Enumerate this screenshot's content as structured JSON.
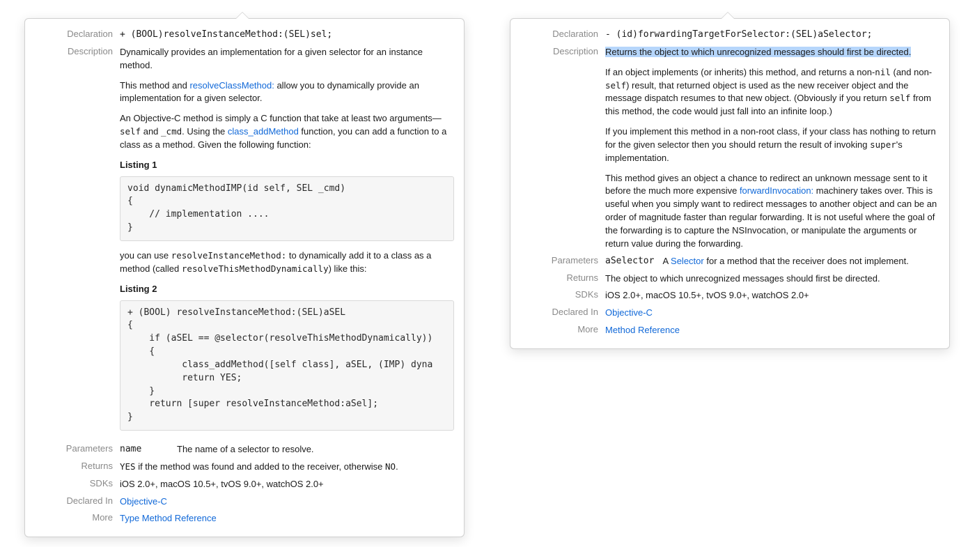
{
  "left": {
    "labels": {
      "declaration": "Declaration",
      "description": "Description",
      "parameters": "Parameters",
      "returns": "Returns",
      "sdks": "SDKs",
      "declaredIn": "Declared In",
      "more": "More"
    },
    "declaration": "+ (BOOL)resolveInstanceMethod:(SEL)sel;",
    "desc": {
      "p1": "Dynamically provides an implementation for a given selector for an instance method.",
      "p2a": "This method and ",
      "p2link": "resolveClassMethod:",
      "p2b": " allow you to dynamically provide an implementation for a given selector.",
      "p3a": "An Objective-C method is simply a C function that take at least two arguments—",
      "p3self": "self",
      "p3b": " and ",
      "p3cmd": "_cmd",
      "p3c": ". Using the ",
      "p3link": "class_addMethod",
      "p3d": " function, you can add a function to a class as a method. Given the following function:",
      "listing1_title": "Listing 1",
      "code1": "void dynamicMethodIMP(id self, SEL _cmd)\n{\n    // implementation ....\n}",
      "p4a": "you can use ",
      "p4code1": "resolveInstanceMethod:",
      "p4b": " to dynamically add it to a class as a method (called ",
      "p4code2": "resolveThisMethodDynamically",
      "p4c": ") like this:",
      "listing2_title": "Listing 2",
      "code2": "+ (BOOL) resolveInstanceMethod:(SEL)aSEL\n{\n    if (aSEL == @selector(resolveThisMethodDynamically))\n    {\n          class_addMethod([self class], aSEL, (IMP) dyna\n          return YES;\n    }\n    return [super resolveInstanceMethod:aSel];\n}"
    },
    "param": {
      "name": "name",
      "text": "The name of a selector to resolve."
    },
    "returns_a": "YES",
    "returns_b": " if the method was found and added to the receiver, otherwise ",
    "returns_c": "NO",
    "returns_d": ".",
    "sdks": "iOS 2.0+, macOS 10.5+, tvOS 9.0+, watchOS 2.0+",
    "declaredIn": "Objective-C",
    "more": "Type Method Reference"
  },
  "right": {
    "labels": {
      "declaration": "Declaration",
      "description": "Description",
      "parameters": "Parameters",
      "returns": "Returns",
      "sdks": "SDKs",
      "declaredIn": "Declared In",
      "more": "More"
    },
    "declaration": "- (id)forwardingTargetForSelector:(SEL)aSelector;",
    "desc": {
      "p1_hl": "Returns the object to which unrecognized messages should first be directed.",
      "p2a": "If an object implements (or inherits) this method, and returns a non-",
      "p2nil": "nil",
      "p2b": " (and non-",
      "p2self": "self",
      "p2c": ") result, that returned object is used as the new receiver object and the message dispatch resumes to that new object. (Obviously if you return ",
      "p2self2": "self",
      "p2d": " from this method, the code would just fall into an infinite loop.)",
      "p3a": "If you implement this method in a non-root class, if your class has nothing to return for the given selector then you should return the result of invoking ",
      "p3super": "super",
      "p3b": "'s implementation.",
      "p4a": "This method gives an object a chance to redirect an unknown message sent to it before the much more expensive ",
      "p4link": "forwardInvocation:",
      "p4b": " machinery takes over. This is useful when you simply want to redirect messages to another object and can be an order of magnitude faster than regular forwarding. It is not useful where the goal of the forwarding is to capture the NSInvocation, or manipulate the arguments or return value during the forwarding."
    },
    "param": {
      "name": "aSelector",
      "text_a": "A ",
      "text_link": "Selector",
      "text_b": " for a method that the receiver does not implement."
    },
    "returns": "The object to which unrecognized messages should first be directed.",
    "sdks": "iOS 2.0+, macOS 10.5+, tvOS 9.0+, watchOS 2.0+",
    "declaredIn": "Objective-C",
    "more": "Method Reference"
  }
}
